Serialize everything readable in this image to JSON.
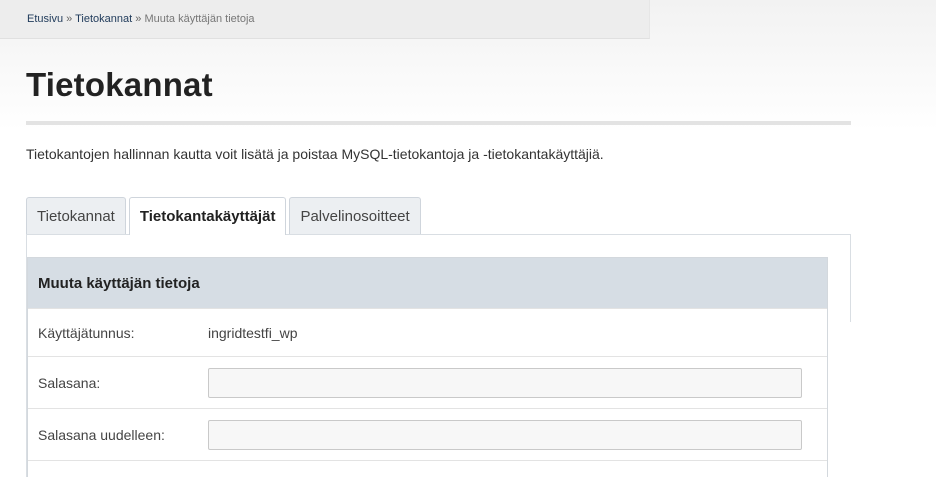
{
  "breadcrumb": {
    "items": [
      "Etusivu",
      "Tietokannat",
      "Muuta käyttäjän tietoja"
    ],
    "separator": "»"
  },
  "page": {
    "title": "Tietokannat",
    "intro": "Tietokantojen hallinnan kautta voit lisätä ja poistaa MySQL-tietokantoja ja -tietokantakäyttäjiä."
  },
  "tabs": [
    {
      "label": "Tietokannat",
      "active": false
    },
    {
      "label": "Tietokantakäyttäjät",
      "active": true
    },
    {
      "label": "Palvelinosoitteet",
      "active": false
    }
  ],
  "form": {
    "header": "Muuta käyttäjän tietoja",
    "username_label": "Käyttäjätunnus:",
    "username_value": "ingridtestfi_wp",
    "password_label": "Salasana:",
    "password_value": "",
    "password_confirm_label": "Salasana uudelleen:",
    "password_confirm_value": ""
  },
  "colors": {
    "header_bg": "#d6dde4",
    "breadcrumb_link": "#1f3a5a",
    "tab_bg": "#eceff2"
  }
}
